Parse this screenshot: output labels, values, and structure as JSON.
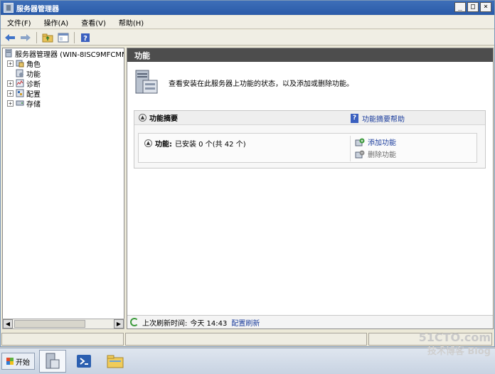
{
  "window": {
    "title": "服务器管理器",
    "controls": {
      "minimize": "_",
      "restore": "□",
      "close": "×"
    }
  },
  "menu": {
    "items": [
      "文件(F)",
      "操作(A)",
      "查看(V)",
      "帮助(H)"
    ]
  },
  "toolbar": {
    "icons": [
      "back-arrow-icon",
      "forward-arrow-icon",
      "up-folder-icon",
      "show-hide-tree-icon",
      "help-icon"
    ]
  },
  "tree": {
    "root": "服务器管理器 (WIN-8ISC9MFCMM",
    "items": [
      {
        "label": "角色",
        "expander": "+"
      },
      {
        "label": "功能",
        "expander": ""
      },
      {
        "label": "诊断",
        "expander": "+"
      },
      {
        "label": "配置",
        "expander": "+"
      },
      {
        "label": "存储",
        "expander": "+"
      }
    ]
  },
  "content": {
    "header": "功能",
    "intro_text": "查看安装在此服务器上功能的状态，以及添加或删除功能。",
    "summary": {
      "title": "功能摘要",
      "help_link": "功能摘要帮助",
      "help_glyph": "?",
      "features_label": "功能:",
      "features_value": "已安装 0 个(共 42 个)",
      "actions": {
        "add": "添加功能",
        "remove": "删除功能"
      }
    },
    "status": {
      "last_refresh_label": "上次刷新时间:",
      "last_refresh_value": "今天 14:43",
      "configure_refresh": "配置刷新"
    }
  },
  "taskbar": {
    "start_label": "开始"
  },
  "watermark": {
    "line1": "51CTO.com",
    "line2": "技术博客 Blog"
  }
}
